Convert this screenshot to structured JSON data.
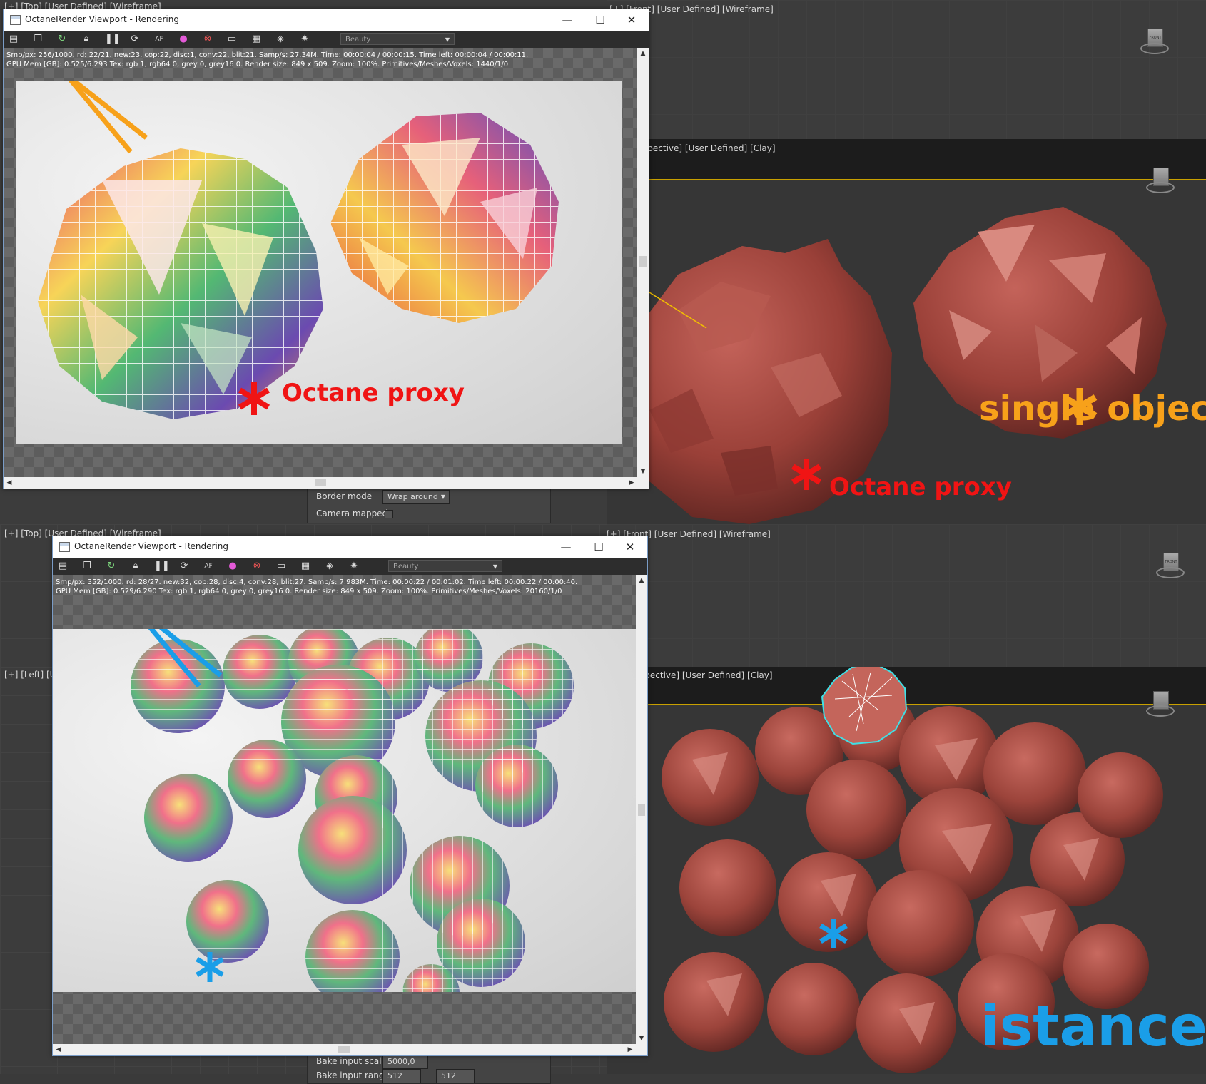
{
  "colors": {
    "orange": "#f7a11a",
    "red": "#f01414",
    "blue": "#1a9ee8",
    "clay": "#a8493f",
    "selection": "#3fe0e6"
  },
  "viewports": {
    "top_top_left": "[+] [Top] [User Defined] [Wireframe]",
    "top_front": "[+] [Front] [User Defined] [Wireframe]",
    "top_perspective": "[+] [Perspective] [User Defined] [Clay]",
    "bottom_top": "[+] [Top] [User Defined] [Wireframe]",
    "bottom_front": "[+] [Front] [User Defined] [Wireframe]",
    "bottom_left": "[+] [Left] [User Defined] [Wireframe]",
    "bottom_perspective": "[+] [Perspective] [User Defined] [Clay]",
    "cube_label": "FRONT"
  },
  "props_panel": {
    "border_mode_label": "Border mode",
    "border_mode_value": "Wrap around",
    "camera_mapped_label": "Camera mapped",
    "bake_scale_label": "Bake input scale",
    "bake_scale_value": "5000,0",
    "bake_range_label": "Bake input range",
    "bake_range_a": "512",
    "bake_range_b": "512"
  },
  "window1": {
    "title": "OctaneRender Viewport - Rendering",
    "render_pass": "Beauty",
    "stats_line1": "Smp/px: 256/1000.   rd: 22/21.   new:23, cop:22, disc:1, conv:22, blit:21.   Samp/s: 27.34M.   Time: 00:00:04 / 00:00:15.   Time left: 00:00:04 / 00:00:11.",
    "stats_line2": "GPU Mem [GB]: 0.525/6.293   Tex: rgb 1, rgb64 0, grey 0, grey16 0.   Render size: 849 x 509.   Zoom: 100%.   Primitives/Meshes/Voxels: 1440/1/0"
  },
  "window2": {
    "title": "OctaneRender Viewport - Rendering",
    "render_pass": "Beauty",
    "stats_line1": "Smp/px: 352/1000.   rd: 28/27.   new:32, cop:28, disc:4, conv:28, blit:27.   Samp/s: 7.983M.   Time: 00:00:22 / 00:01:02.   Time left: 00:00:22 / 00:00:40.",
    "stats_line2": "GPU Mem [GB]: 0.529/6.290   Tex: rgb 1, rgb64 0, grey 0, grey16 0.   Render size: 849 x 509.   Zoom: 100%.   Primitives/Meshes/Voxels: 20160/1/0"
  },
  "annotations": {
    "octane_proxy_render": "Octane proxy",
    "octane_proxy_clay": "Octane proxy",
    "single_object": "single object",
    "instanced": "istanced"
  },
  "window_buttons": {
    "minimize": "—",
    "maximize": "☐",
    "close": "✕"
  },
  "toolbar_icons": [
    "save-icon",
    "copy-icon",
    "restart-icon",
    "lock-icon",
    "pause-icon",
    "refresh-icon",
    "af-icon",
    "color-wheel-icon",
    "region-icon",
    "display-icon",
    "film-icon",
    "material-icon",
    "settings-icon"
  ]
}
